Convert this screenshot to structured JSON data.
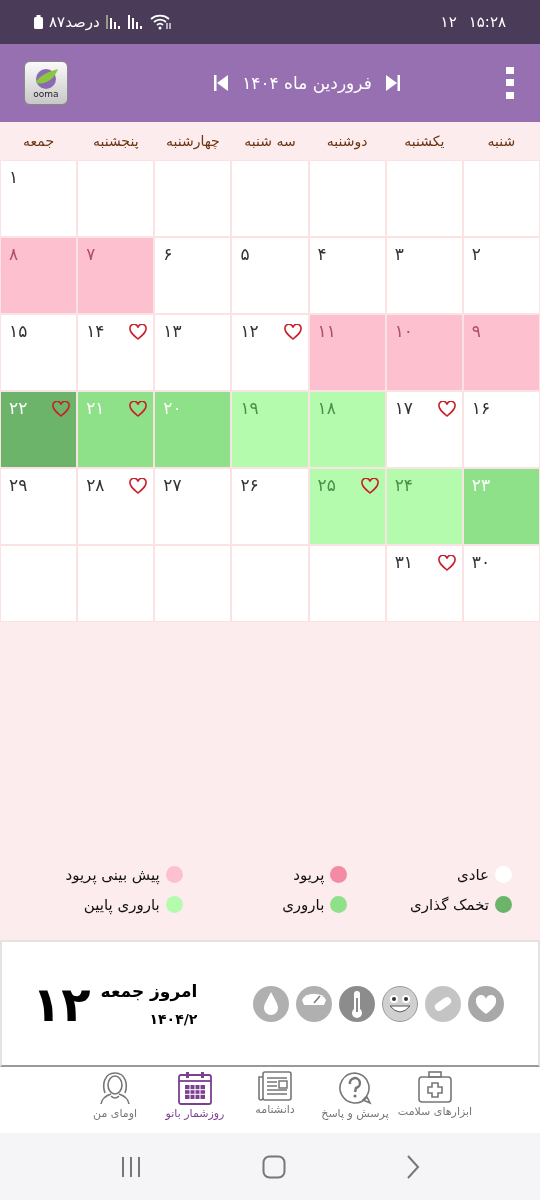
{
  "status_bar": {
    "battery_text": "۸۷درصد",
    "notifications": "۱۲",
    "time": "۱۵:۲۸"
  },
  "header": {
    "logo_text": "ooma",
    "title": "فروردین ماه ۱۴۰۴"
  },
  "weekdays": [
    "شنبه",
    "یکشنبه",
    "دوشنبه",
    "سه شنبه",
    "چهارشنبه",
    "پنجشنبه",
    "جمعه"
  ],
  "weeks": [
    [
      {
        "kind": "blank"
      },
      {
        "kind": "blank"
      },
      {
        "kind": "blank"
      },
      {
        "kind": "blank"
      },
      {
        "kind": "blank"
      },
      {
        "kind": "blank"
      },
      {
        "day": "۱",
        "kind": "normal",
        "heart": false
      }
    ],
    [
      {
        "day": "۲",
        "kind": "normal",
        "heart": false
      },
      {
        "day": "۳",
        "kind": "normal",
        "heart": false
      },
      {
        "day": "۴",
        "kind": "normal",
        "heart": false
      },
      {
        "day": "۵",
        "kind": "normal",
        "heart": false
      },
      {
        "day": "۶",
        "kind": "normal",
        "heart": false
      },
      {
        "day": "۷",
        "kind": "predicted",
        "heart": false
      },
      {
        "day": "۸",
        "kind": "predicted",
        "heart": false
      }
    ],
    [
      {
        "day": "۹",
        "kind": "predicted",
        "heart": false
      },
      {
        "day": "۱۰",
        "kind": "predicted",
        "heart": false
      },
      {
        "day": "۱۱",
        "kind": "predicted",
        "heart": false
      },
      {
        "day": "۱۲",
        "kind": "normal",
        "heart": true
      },
      {
        "day": "۱۳",
        "kind": "normal",
        "heart": false
      },
      {
        "day": "۱۴",
        "kind": "normal",
        "heart": true
      },
      {
        "day": "۱۵",
        "kind": "normal",
        "heart": false
      }
    ],
    [
      {
        "day": "۱۶",
        "kind": "normal",
        "heart": false
      },
      {
        "day": "۱۷",
        "kind": "normal",
        "heart": true
      },
      {
        "day": "۱۸",
        "kind": "lowfertility",
        "heart": false
      },
      {
        "day": "۱۹",
        "kind": "lowfertility",
        "heart": false
      },
      {
        "day": "۲۰",
        "kind": "fertility",
        "heart": false
      },
      {
        "day": "۲۱",
        "kind": "fertility",
        "heart": true
      },
      {
        "day": "۲۲",
        "kind": "ovulation",
        "heart": true
      }
    ],
    [
      {
        "day": "۲۳",
        "kind": "fertility",
        "heart": false
      },
      {
        "day": "۲۴",
        "kind": "lowfertility",
        "heart": false
      },
      {
        "day": "۲۵",
        "kind": "lowfertility",
        "heart": true
      },
      {
        "day": "۲۶",
        "kind": "normal",
        "heart": false
      },
      {
        "day": "۲۷",
        "kind": "normal",
        "heart": false
      },
      {
        "day": "۲۸",
        "kind": "normal",
        "heart": true
      },
      {
        "day": "۲۹",
        "kind": "normal",
        "heart": false
      }
    ],
    [
      {
        "day": "۳۰",
        "kind": "normal",
        "heart": false
      },
      {
        "day": "۳۱",
        "kind": "normal",
        "heart": true
      },
      {
        "kind": "blank"
      },
      {
        "kind": "blank"
      },
      {
        "kind": "blank"
      },
      {
        "kind": "blank"
      },
      {
        "kind": "blank"
      }
    ]
  ],
  "legend": [
    {
      "label": "عادی",
      "kind": "normal",
      "color": "#ffffff"
    },
    {
      "label": "پریود",
      "kind": "period",
      "color": "#f48aa4"
    },
    {
      "label": "پیش بینی پریود",
      "kind": "predicted",
      "color": "#fdc0cf"
    },
    {
      "label": "تخمک گذاری",
      "kind": "ovulation",
      "color": "#6db46b"
    },
    {
      "label": "باروری",
      "kind": "fertility",
      "color": "#8ee189"
    },
    {
      "label": "باروری پایین",
      "kind": "lowfertility",
      "color": "#b4fbae"
    }
  ],
  "today": {
    "day": "۱۲",
    "label": "امروز جمعه",
    "date": "۱۴۰۴/۲"
  },
  "nav": [
    {
      "label": "ابزارهای سلامت",
      "selected": false
    },
    {
      "label": "پرسش و پاسخ",
      "selected": false
    },
    {
      "label": "دانشنامه",
      "selected": false
    },
    {
      "label": "روزشمار بانو",
      "selected": true
    },
    {
      "label": "اومای من",
      "selected": false
    }
  ]
}
